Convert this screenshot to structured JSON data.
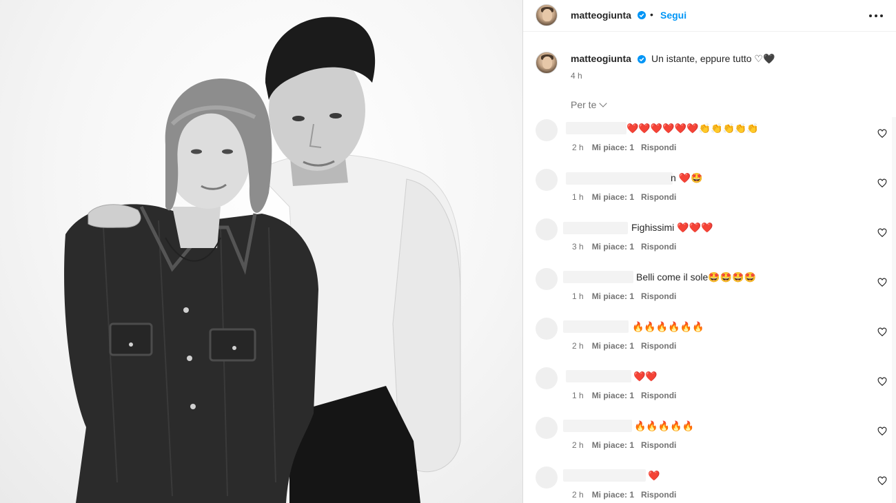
{
  "post": {
    "username": "matteogiunta",
    "separator": "•",
    "follow_label": "Segui",
    "caption": "Un istante, eppure tutto ♡🖤",
    "caption_time": "4 h",
    "sort_label": "Per te"
  },
  "comments": [
    {
      "text": "❤️❤️❤️❤️❤️❤️👏👏👏👏👏",
      "time": "2 h",
      "likes": "Mi piace: 1",
      "reply": "Rispondi"
    },
    {
      "text": "n ❤️🤩",
      "time": "1 h",
      "likes": "Mi piace: 1",
      "reply": "Rispondi"
    },
    {
      "text": "Fighissimi ❤️❤️❤️",
      "time": "3 h",
      "likes": "Mi piace: 1",
      "reply": "Rispondi"
    },
    {
      "text": "Belli come il sole🤩🤩🤩🤩",
      "time": "1 h",
      "likes": "Mi piace: 1",
      "reply": "Rispondi"
    },
    {
      "text": "🔥🔥🔥🔥🔥🔥",
      "time": "2 h",
      "likes": "Mi piace: 1",
      "reply": "Rispondi"
    },
    {
      "text": "❤️❤️",
      "time": "1 h",
      "likes": "Mi piace: 1",
      "reply": "Rispondi"
    },
    {
      "text": "🔥🔥🔥🔥🔥",
      "time": "2 h",
      "likes": "Mi piace: 1",
      "reply": "Rispondi"
    },
    {
      "text": "❤️",
      "time": "2 h",
      "likes": "Mi piace: 1",
      "reply": "Rispondi"
    }
  ],
  "colors": {
    "link": "#0095f6",
    "verified": "#0095f6",
    "muted": "#737373"
  },
  "icons": {
    "more": "more-icon",
    "like": "heart-icon",
    "verified": "verified-badge-icon",
    "sort": "chevron-down-icon"
  }
}
